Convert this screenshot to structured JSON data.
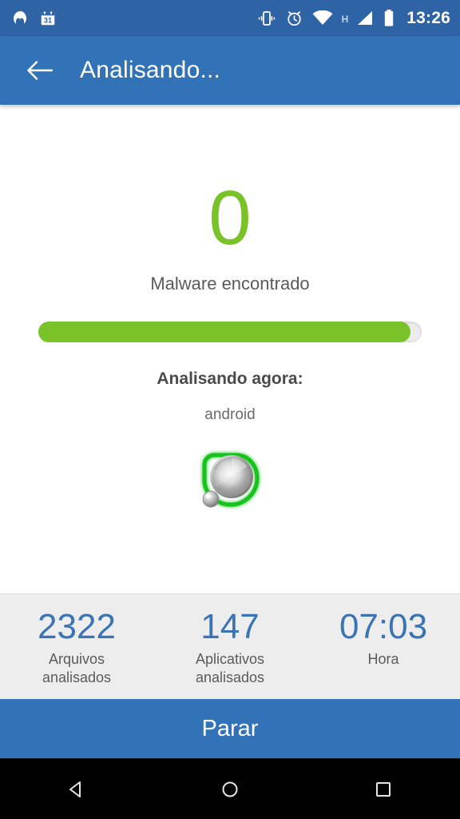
{
  "status_bar": {
    "icons": [
      {
        "name": "malwarebytes-logo-icon",
        "label": "Malwarebytes"
      },
      {
        "name": "calendar-icon",
        "label": "31"
      },
      {
        "name": "vibrate-icon",
        "label": "Vibrate"
      },
      {
        "name": "alarm-clock-icon",
        "label": "Alarm"
      },
      {
        "name": "wifi-icon",
        "label": "Wi-Fi"
      },
      {
        "name": "network-type-icon",
        "label": "H"
      },
      {
        "name": "signal-bars-icon",
        "label": "Signal"
      },
      {
        "name": "battery-icon",
        "label": "Battery"
      }
    ],
    "calendar_day": "31",
    "network_type": "H",
    "time": "13:26",
    "background_color": "#2E63A6"
  },
  "app_bar": {
    "back_label": "Voltar",
    "title": "Analisando...",
    "background_color": "#3273B8"
  },
  "scan": {
    "malware_count": "0",
    "malware_count_color": "#7AC229",
    "malware_label": "Malware encontrado",
    "progress_percent": 97,
    "progress_fill_color": "#7AC229",
    "progress_track_color": "#ECECEC",
    "scanning_now_label": "Analisando agora:",
    "scanning_now_value": "android",
    "scan_icon_name": "scanning-disc-icon"
  },
  "stats": [
    {
      "value": "2322",
      "label": "Arquivos\nanalisados",
      "name": "files-scanned"
    },
    {
      "value": "147",
      "label": "Aplicativos\nanalisados",
      "name": "apps-scanned"
    },
    {
      "value": "07:03",
      "label": "Hora",
      "name": "elapsed-time"
    }
  ],
  "stats_value_color": "#3B74B4",
  "stop_button": {
    "label": "Parar",
    "background_color": "#3273B8"
  },
  "nav_bar": {
    "back_label": "Back",
    "home_label": "Home",
    "recents_label": "Recents"
  }
}
